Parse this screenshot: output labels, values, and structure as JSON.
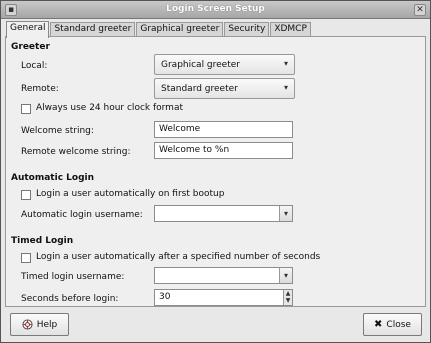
{
  "window": {
    "title": "Login Screen Setup"
  },
  "tabs": [
    "General",
    "Standard greeter",
    "Graphical greeter",
    "Security",
    "XDMCP"
  ],
  "greeter": {
    "heading": "Greeter",
    "local_label": "Local:",
    "local_value": "Graphical greeter",
    "remote_label": "Remote:",
    "remote_value": "Standard greeter",
    "clock_label": "Always use 24 hour clock format",
    "welcome_label": "Welcome string:",
    "welcome_value": "Welcome",
    "remote_welcome_label": "Remote welcome string:",
    "remote_welcome_value": "Welcome to %n"
  },
  "automatic_login": {
    "heading": "Automatic Login",
    "check_label": "Login a user automatically on first bootup",
    "username_label": "Automatic login username:",
    "username_value": ""
  },
  "timed_login": {
    "heading": "Timed Login",
    "check_label": "Login a user automatically after a specified number of seconds",
    "username_label": "Timed login username:",
    "username_value": "",
    "seconds_label": "Seconds before login:",
    "seconds_value": "30"
  },
  "buttons": {
    "help": "Help",
    "close": "Close"
  },
  "icons": {
    "help": "lifebuoy-icon",
    "close": "x-close-icon",
    "dropdown": "triangle-down-icon",
    "combo_dropdown": "chevron-down-icon",
    "spin": "spinner-arrows-icon"
  }
}
